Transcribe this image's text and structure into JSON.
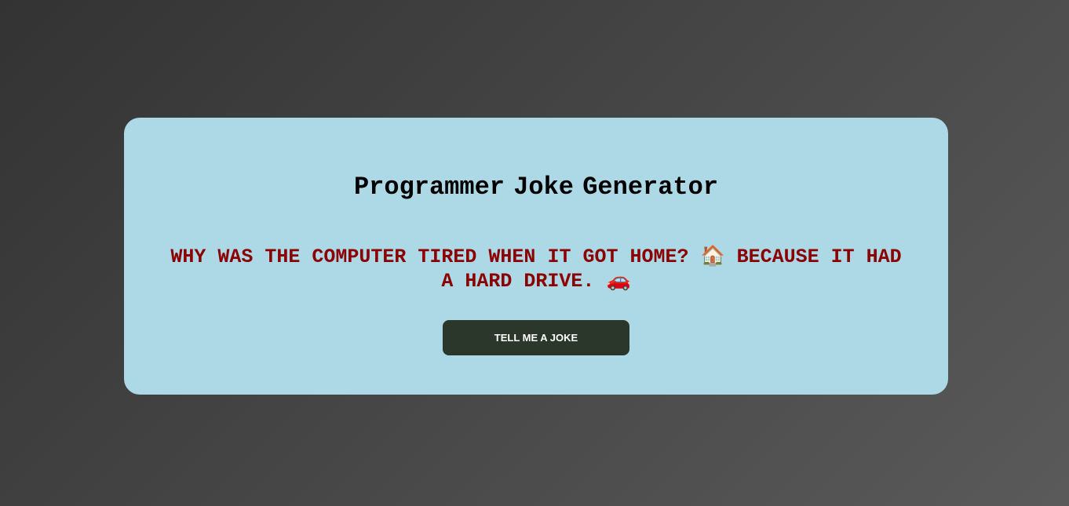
{
  "app": {
    "title": "Programmer Joke Generator",
    "joke_text": "WHY WAS THE COMPUTER TIRED WHEN IT GOT HOME? 🏠 BECAUSE IT HAD A HARD DRIVE. 🚗",
    "button_label": "TELL ME A JOKE"
  },
  "colors": {
    "card_background": "#add8e6",
    "joke_text": "#8b0000",
    "button_background": "#2b372b",
    "button_text": "#ffffff"
  }
}
